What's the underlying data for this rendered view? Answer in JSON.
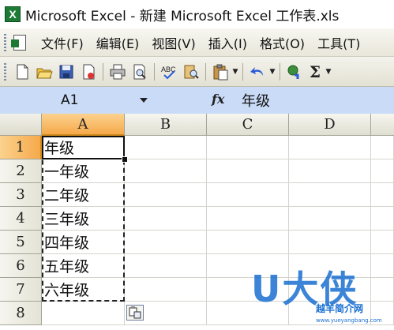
{
  "window": {
    "title": "Microsoft Excel - 新建 Microsoft Excel 工作表.xls",
    "app_icon_label": "X"
  },
  "menu": {
    "items": [
      "文件(F)",
      "编辑(E)",
      "视图(V)",
      "插入(I)",
      "格式(O)",
      "工具(T)"
    ]
  },
  "toolbar": {
    "icons": [
      "new-icon",
      "open-icon",
      "save-icon",
      "permission-icon",
      "print-icon",
      "print-preview-icon",
      "spelling-icon",
      "research-icon",
      "paste-icon",
      "undo-icon",
      "hyperlink-icon",
      "autosum-icon"
    ],
    "autosum_label": "Σ"
  },
  "formula_bar": {
    "name_box": "A1",
    "fx_label": "fx",
    "formula": "年级"
  },
  "sheet": {
    "columns": [
      "A",
      "B",
      "C",
      "D"
    ],
    "rows": [
      "1",
      "2",
      "3",
      "4",
      "5",
      "6",
      "7",
      "8"
    ],
    "cells_col_a": [
      "年级",
      "一年级",
      "二年级",
      "三年级",
      "四年级",
      "五年级",
      "六年级",
      ""
    ],
    "selected_column": "A",
    "selected_row": "1"
  },
  "watermark": {
    "logo_text": "U大侠",
    "site_name": "越羊简介网",
    "url": "www.yueyangbang.com"
  },
  "colors": {
    "selection_header": "#f6a94a",
    "formula_bar_bg": "#c9dbf7",
    "excel_green": "#1d7a35"
  }
}
